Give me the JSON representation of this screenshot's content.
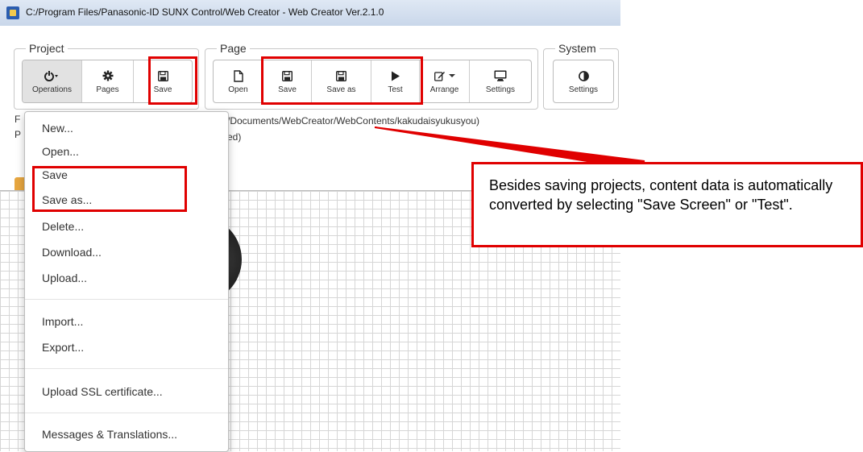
{
  "window": {
    "title": "C:/Program Files/Panasonic-ID SUNX Control/Web Creator - Web Creator Ver.2.1.0"
  },
  "groups": {
    "project": "Project",
    "page": "Page",
    "system": "System"
  },
  "project_buttons": {
    "operations": "Operations",
    "pages": "Pages",
    "save": "Save"
  },
  "page_buttons": {
    "open": "Open",
    "save": "Save",
    "save_as": "Save as",
    "test": "Test",
    "arrange": "Arrange",
    "settings": "Settings"
  },
  "system_buttons": {
    "settings": "Settings"
  },
  "info": {
    "line1_prefix": "F",
    "line1": "/Documents/WebCreator/WebContents/kakudaisyukusyou)",
    "line2_prefix": "P",
    "line2": "ed)"
  },
  "menu": {
    "items": [
      "New...",
      "Open...",
      "Save",
      "Save as...",
      "Delete...",
      "Download...",
      "Upload...",
      "Import...",
      "Export...",
      "Upload SSL certificate...",
      "Messages & Translations..."
    ]
  },
  "callout": {
    "text": "Besides saving projects, content data is automatically converted by selecting \"Save Screen\" or \"Test\"."
  },
  "colors": {
    "highlight": "#e00000",
    "accent_orange": "#e7a640"
  }
}
